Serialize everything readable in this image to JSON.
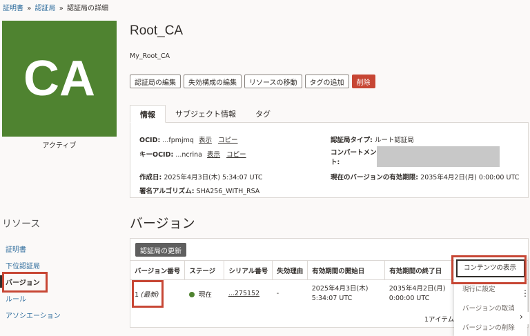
{
  "breadcrumb": {
    "items": [
      "証明書",
      "認証局"
    ],
    "separator": "»",
    "current": "認証局の詳細"
  },
  "tile": {
    "text": "CA",
    "color": "#4f8330"
  },
  "state": "アクティブ",
  "header": {
    "title": "Root_CA",
    "subtitle": "My_Root_CA"
  },
  "actions": {
    "edit_ca": "認証局の編集",
    "edit_revocation": "失効構成の編集",
    "move_resource": "リソースの移動",
    "add_tags": "タグの追加",
    "delete": "削除"
  },
  "tabs": [
    "情報",
    "サブジェクト情報",
    "タグ"
  ],
  "info": {
    "ocid_label": "OCID:",
    "ocid_value": "...fpmjmq",
    "key_ocid_label": "キーOCID:",
    "key_ocid_value": "...ncrina",
    "show": "表示",
    "copy": "コピー",
    "created_label": "作成日:",
    "created_value": "2025年4月3日(木) 5:34:07 UTC",
    "algo_label": "署名アルゴリズム:",
    "algo_value": "SHA256_WITH_RSA",
    "ca_type_label": "認証局タイプ:",
    "ca_type_value": "ルート認証局",
    "compartment_label_1": "コンパートメン",
    "compartment_label_2": "ト:",
    "current_expiry_label": "現在のバージョンの有効期限:",
    "current_expiry_value": "2035年4月2日(月) 0:00:00 UTC"
  },
  "resources": {
    "title": "リソース",
    "items": [
      "証明書",
      "下位認証局",
      "バージョン",
      "ルール",
      "アソシエーション"
    ]
  },
  "versions": {
    "title": "バージョン",
    "update_button": "認証局の更新",
    "columns": [
      "バージョン番号",
      "ステージ",
      "シリアル番号",
      "失効理由",
      "有効期間の開始日",
      "有効期間の終了日"
    ],
    "row": {
      "number": "1",
      "latest": "(最新)",
      "stage": "現在",
      "serial": "...275152",
      "revocation": "-",
      "start_1": "2025年4月3日(木)",
      "start_2": "5:34:07 UTC",
      "end_1": "2035年4月2日(月)",
      "end_2": "0:00:00 UTC"
    },
    "pager": "1アイテムを"
  },
  "menu": {
    "view_contents": "コンテンツの表示",
    "set_current": "現行に設定",
    "cancel_version": "バージョンの取消",
    "delete_version": "バージョンの削除"
  }
}
